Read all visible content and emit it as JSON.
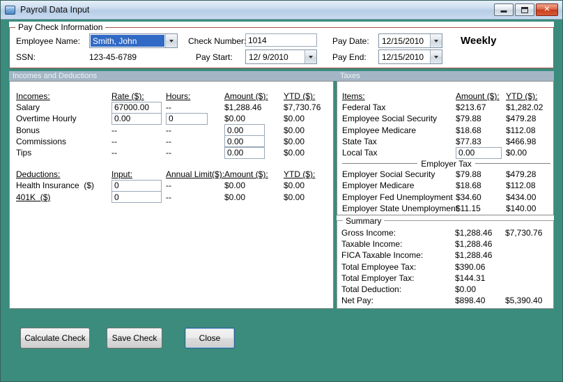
{
  "window": {
    "title": "Payroll Data Input"
  },
  "icons": {
    "close_glyph": "✕"
  },
  "colors": {
    "form_background": "#3B8C7C",
    "paycheck_border": "#B0504C",
    "section_header_bg": "#A4B6C6",
    "combo_selection": "#316AC5",
    "close_button_red": "#C63F1D"
  },
  "paycheck": {
    "group_label": "Pay Check Information",
    "employee_name": {
      "label": "Employee Name:",
      "value": "Smith, John"
    },
    "ssn": {
      "label": "SSN:",
      "value": "123-45-6789"
    },
    "check_number": {
      "label": "Check Number:",
      "value": "1014"
    },
    "pay_start": {
      "label": "Pay Start:",
      "value": "12/ 9/2010"
    },
    "pay_date": {
      "label": "Pay Date:",
      "value": "12/15/2010"
    },
    "pay_end": {
      "label": "Pay End:",
      "value": "12/15/2010"
    },
    "frequency": "Weekly"
  },
  "section_headers": {
    "left": "Incomes and Deductions",
    "right": "Taxes"
  },
  "incomes": {
    "headers": {
      "c0": "Incomes:",
      "c1": "Rate ($):",
      "c2": "Hours:",
      "c3": "Amount ($):",
      "c4": "YTD ($):"
    },
    "rows": [
      {
        "label": "Salary",
        "rate": "67000.00",
        "hours": "--",
        "amount": "$1,288.46",
        "ytd": "$7,730.76"
      },
      {
        "label": "Overtime Hourly",
        "rate": "0.00",
        "hours": "0",
        "amount": "$0.00",
        "ytd": "$0.00"
      },
      {
        "label": "Bonus",
        "rate": "--",
        "hours": "--",
        "amount": "0.00",
        "ytd": "$0.00"
      },
      {
        "label": "Commissions",
        "rate": "--",
        "hours": "--",
        "amount": "0.00",
        "ytd": "$0.00"
      },
      {
        "label": "Tips",
        "rate": "--",
        "hours": "--",
        "amount": "0.00",
        "ytd": "$0.00"
      }
    ]
  },
  "deductions": {
    "headers": {
      "c0": "Deductions:",
      "c1": "Input:",
      "c2": "Annual Limit($):",
      "c3": "Amount ($):",
      "c4": "YTD ($):"
    },
    "rows": [
      {
        "label": "Health Insurance  ($)",
        "input": "0",
        "limit": "--",
        "amount": "$0.00",
        "ytd": "$0.00"
      },
      {
        "label": "401K  ($)",
        "input": "0",
        "limit": "--",
        "amount": "$0.00",
        "ytd": "$0.00"
      }
    ]
  },
  "taxes": {
    "headers": {
      "c0": "Items:",
      "c1": "Amount ($):",
      "c2": "YTD ($):"
    },
    "employee_rows": [
      {
        "label": "Federal Tax",
        "amount": "$213.67",
        "ytd": "$1,282.02"
      },
      {
        "label": "Employee Social Security",
        "amount": "$79.88",
        "ytd": "$479.28"
      },
      {
        "label": "Employee Medicare",
        "amount": "$18.68",
        "ytd": "$112.08"
      },
      {
        "label": "State Tax",
        "amount": "$77.83",
        "ytd": "$466.98"
      },
      {
        "label": "Local Tax",
        "amount": "0.00",
        "ytd": "$0.00"
      }
    ],
    "divider_label": "Employer Tax",
    "employer_rows": [
      {
        "label": "Employer Social Security",
        "amount": "$79.88",
        "ytd": "$479.28"
      },
      {
        "label": "Employer Medicare",
        "amount": "$18.68",
        "ytd": "$112.08"
      },
      {
        "label": "Employer Fed Unemployment",
        "amount": "$34.60",
        "ytd": "$434.00"
      },
      {
        "label": "Employer State Unemployment",
        "amount": "$11.15",
        "ytd": "$140.00"
      }
    ]
  },
  "summary": {
    "group_label": "Summary",
    "rows": [
      {
        "label": "Gross Income:",
        "value": "$1,288.46",
        "ytd": "$7,730.76"
      },
      {
        "label": "Taxable Income:",
        "value": "$1,288.46",
        "ytd": ""
      },
      {
        "label": "FICA Taxable Income:",
        "value": "$1,288.46",
        "ytd": ""
      },
      {
        "label": "Total Employee Tax:",
        "value": "$390.06",
        "ytd": ""
      },
      {
        "label": "Total Employer Tax:",
        "value": "$144.31",
        "ytd": ""
      },
      {
        "label": "Total Deduction:",
        "value": "$0.00",
        "ytd": ""
      },
      {
        "label": "Net Pay:",
        "value": "$898.40",
        "ytd": "$5,390.40"
      }
    ]
  },
  "buttons": {
    "calculate": "Calculate Check",
    "save": "Save Check",
    "close": "Close"
  }
}
